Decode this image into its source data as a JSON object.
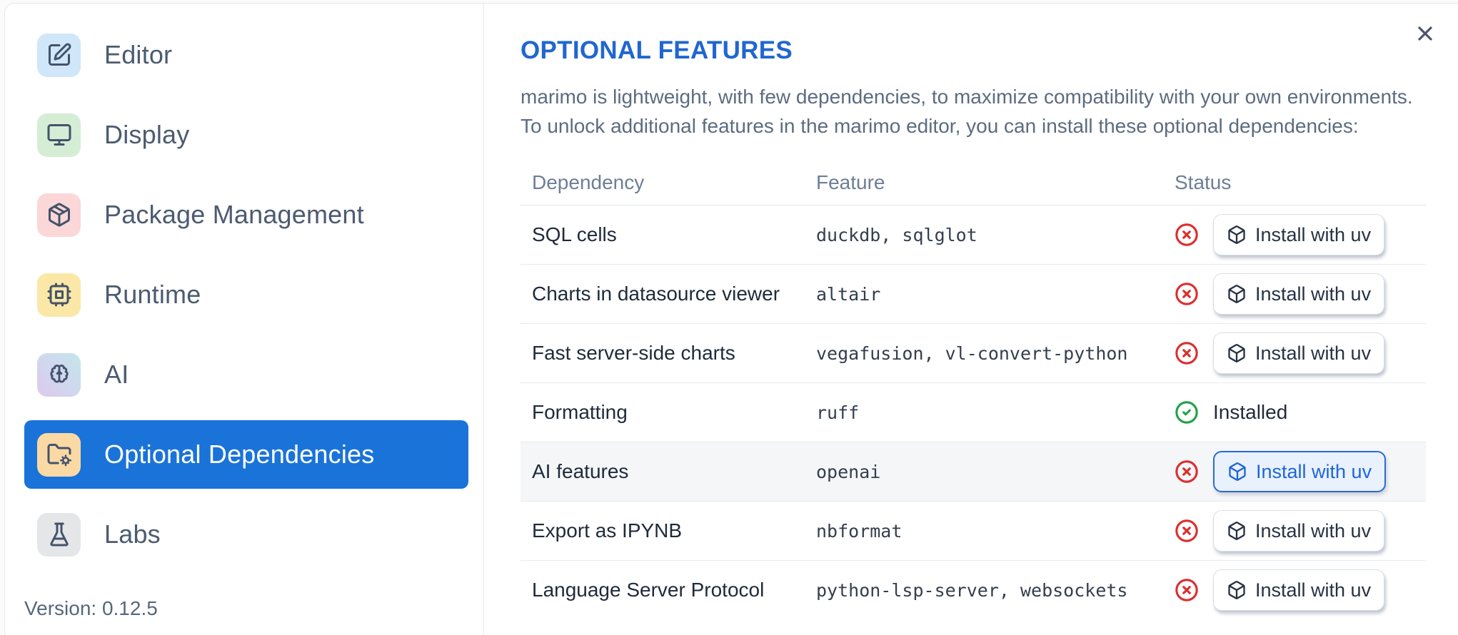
{
  "sidebar": {
    "items": [
      {
        "label": "Editor",
        "icon": "square-pen-icon",
        "icon_bg": "#cfe7f8",
        "selected": false
      },
      {
        "label": "Display",
        "icon": "monitor-icon",
        "icon_bg": "#d5edd5",
        "selected": false
      },
      {
        "label": "Package Management",
        "icon": "package-icon",
        "icon_bg": "#fbd7d8",
        "selected": false
      },
      {
        "label": "Runtime",
        "icon": "cpu-icon",
        "icon_bg": "#fbe8a6",
        "selected": false
      },
      {
        "label": "AI",
        "icon": "brain-icon",
        "icon_bg": "linear-gradient(45deg,#ddc9ef 0%,#c3e6ec 100%)",
        "selected": false
      },
      {
        "label": "Optional Dependencies",
        "icon": "folder-cog-icon",
        "icon_bg": "#fbd9a5",
        "selected": true
      },
      {
        "label": "Labs",
        "icon": "flask-icon",
        "icon_bg": "#e5e6e8",
        "selected": false
      }
    ],
    "version_label": "Version: 0.12.5"
  },
  "panel": {
    "title": "OPTIONAL FEATURES",
    "description_lines": [
      "marimo is lightweight, with few dependencies, to maximize compatibility with your own environments.",
      "To unlock additional features in the marimo editor, you can install these optional dependencies:"
    ],
    "table": {
      "headers": [
        "Dependency",
        "Feature",
        "Status"
      ],
      "rows": [
        {
          "dependency": "SQL cells",
          "feature": "duckdb, sqlglot",
          "status": "missing",
          "action_label": "Install with uv",
          "highlighted": false
        },
        {
          "dependency": "Charts in datasource viewer",
          "feature": "altair",
          "status": "missing",
          "action_label": "Install with uv",
          "highlighted": false
        },
        {
          "dependency": "Fast server-side charts",
          "feature": "vegafusion, vl-convert-python",
          "status": "missing",
          "action_label": "Install with uv",
          "highlighted": false
        },
        {
          "dependency": "Formatting",
          "feature": "ruff",
          "status": "installed",
          "status_label": "Installed",
          "highlighted": false
        },
        {
          "dependency": "AI features",
          "feature": "openai",
          "status": "missing",
          "action_label": "Install with uv",
          "highlighted": true
        },
        {
          "dependency": "Export as IPYNB",
          "feature": "nbformat",
          "status": "missing",
          "action_label": "Install with uv",
          "highlighted": false
        },
        {
          "dependency": "Language Server Protocol",
          "feature": "python-lsp-server, websockets",
          "status": "missing",
          "action_label": "Install with uv",
          "highlighted": false
        }
      ]
    }
  },
  "colors": {
    "accent_blue": "#1a73d8",
    "title_blue": "#2166d0",
    "focus_button_blue": "#2b6ad1",
    "error_red": "#da2f2f",
    "success_green": "#22a14a"
  }
}
